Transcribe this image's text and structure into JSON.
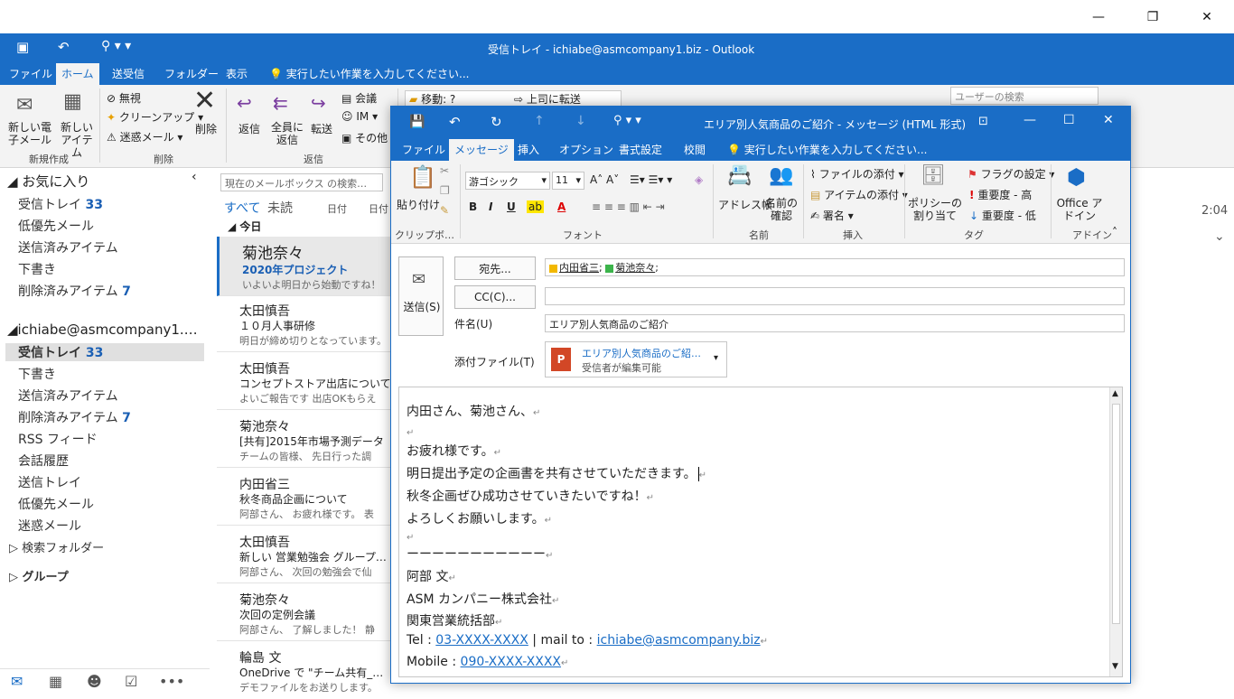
{
  "outlook": {
    "title": "受信トレイ - ichiabe@asmcompany1.biz - Outlook",
    "tabs": [
      "ファイル",
      "ホーム",
      "送受信",
      "フォルダー",
      "表示"
    ],
    "tell_me": "実行したい作業を入力してください...",
    "ribbon": {
      "new_email": "新しい電子メール",
      "new_items": "新しいアイテム",
      "new_group": "新規作成",
      "ignore": "無視",
      "cleanup": "クリーンアップ",
      "junk": "迷惑メール",
      "delete": "削除",
      "delete_group": "削除",
      "reply": "返信",
      "reply_all": "全員に返信",
      "forward": "転送",
      "meeting": "会議",
      "im": "IM",
      "other": "その他",
      "respond_group": "返信",
      "move_to": "移動: ?",
      "to_manager": "上司に転送",
      "user_search_placeholder": "ユーザーの検索"
    },
    "folders": {
      "favorites": "お気に入り",
      "fav_items": [
        {
          "label": "受信トレイ",
          "count": "33"
        },
        {
          "label": "低優先メール",
          "count": ""
        },
        {
          "label": "送信済みアイテム",
          "count": ""
        },
        {
          "label": "下書き",
          "count": ""
        },
        {
          "label": "削除済みアイテム",
          "count": "7"
        }
      ],
      "account": "ichiabe@asmcompany1.…",
      "acc_items": [
        {
          "label": "受信トレイ",
          "count": "33"
        },
        {
          "label": "下書き",
          "count": ""
        },
        {
          "label": "送信済みアイテム",
          "count": ""
        },
        {
          "label": "削除済みアイテム",
          "count": "7"
        },
        {
          "label": "RSS フィード",
          "count": ""
        },
        {
          "label": "会話履歴",
          "count": ""
        },
        {
          "label": "送信トレイ",
          "count": ""
        },
        {
          "label": "低優先メール",
          "count": ""
        },
        {
          "label": "迷惑メール",
          "count": ""
        }
      ],
      "search_folders": "検索フォルダー",
      "groups": "グループ"
    },
    "list": {
      "search_placeholder": "現在のメールボックス の検索…",
      "filter_all": "すべて",
      "filter_unread": "未読",
      "sort_date": "日付",
      "sort_date2": "日付",
      "today": "今日",
      "items": [
        {
          "sender": "菊池奈々",
          "subject": "2020年プロジェクト",
          "preview": "いよいよ明日から始動ですね！"
        },
        {
          "sender": "太田慎吾",
          "subject": "１０月人事研修",
          "preview": "明日が締め切りとなっています。"
        },
        {
          "sender": "太田慎吾",
          "subject": "コンセプトストア出店について",
          "preview": "よいご報告です 出店OKもらえ"
        },
        {
          "sender": "菊池奈々",
          "subject": "[共有]2015年市場予測データ",
          "preview": "チームの皆様、 先日行った調"
        },
        {
          "sender": "内田省三",
          "subject": "秋冬商品企画について",
          "preview": "阿部さん、 お疲れ様です。 表"
        },
        {
          "sender": "太田慎吾",
          "subject": "新しい 営業勉強会 グループ…",
          "preview": "阿部さん、 次回の勉強会で仙"
        },
        {
          "sender": "菊池奈々",
          "subject": "次回の定例会議",
          "preview": "阿部さん、 了解しました！ 静"
        },
        {
          "sender": "輪島 文",
          "subject": "OneDrive で \"チーム共有_…",
          "preview": "デモファイルをお送りします。"
        }
      ]
    },
    "reading_time": "2:04"
  },
  "compose": {
    "title": "エリア別人気商品のご紹介 - メッセージ (HTML 形式)",
    "tabs": [
      "ファイル",
      "メッセージ",
      "挿入",
      "オプション",
      "書式設定",
      "校閲"
    ],
    "tell_me": "実行したい作業を入力してください...",
    "ribbon": {
      "paste": "貼り付け",
      "clipboard": "クリップボ…",
      "font_name": "游ゴシック",
      "font_size": "11",
      "font_group": "フォント",
      "address_book": "アドレス帳",
      "check_names": "名前の確認",
      "names_group": "名前",
      "attach_file": "ファイルの添付",
      "attach_item": "アイテムの添付",
      "signature": "署名",
      "insert_group": "挿入",
      "policy": "ポリシーの割り当て",
      "flag": "フラグの設定",
      "importance_high": "重要度 - 高",
      "importance_low": "重要度 - 低",
      "tags_group": "タグ",
      "office_addins": "Office アドイン",
      "addins_group": "アドイン"
    },
    "send": "送信(S)",
    "to_label": "宛先...",
    "cc_label": "CC(C)...",
    "subject_label": "件名(U)",
    "attach_label": "添付ファイル(T)",
    "to_recipients": [
      "内田省三",
      "菊池奈々"
    ],
    "subject": "エリア別人気商品のご紹介",
    "attachment_name": "エリア別人気商品のご紹…",
    "attachment_sub": "受信者が編集可能",
    "body": [
      "内田さん、菊池さん、",
      "",
      "お疲れ様です。",
      "明日提出予定の企画書を共有させていただきます。",
      "秋冬企画ぜひ成功させていきたいですね！",
      "よろしくお願いします。",
      "",
      "ーーーーーーーーーーー",
      "阿部 文",
      "ASM カンパニー株式会社",
      "関東営業統括部"
    ],
    "tel_label": "Tel : ",
    "tel": "03-XXXX-XXXX",
    "mail_label": " | mail to : ",
    "mail": "ichiabe@asmcompany.biz",
    "mobile_label": "Mobile : ",
    "mobile": "090-XXXX-XXXX"
  },
  "colors": {
    "accent": "#1a6dc6",
    "link": "#1a6dc6"
  }
}
